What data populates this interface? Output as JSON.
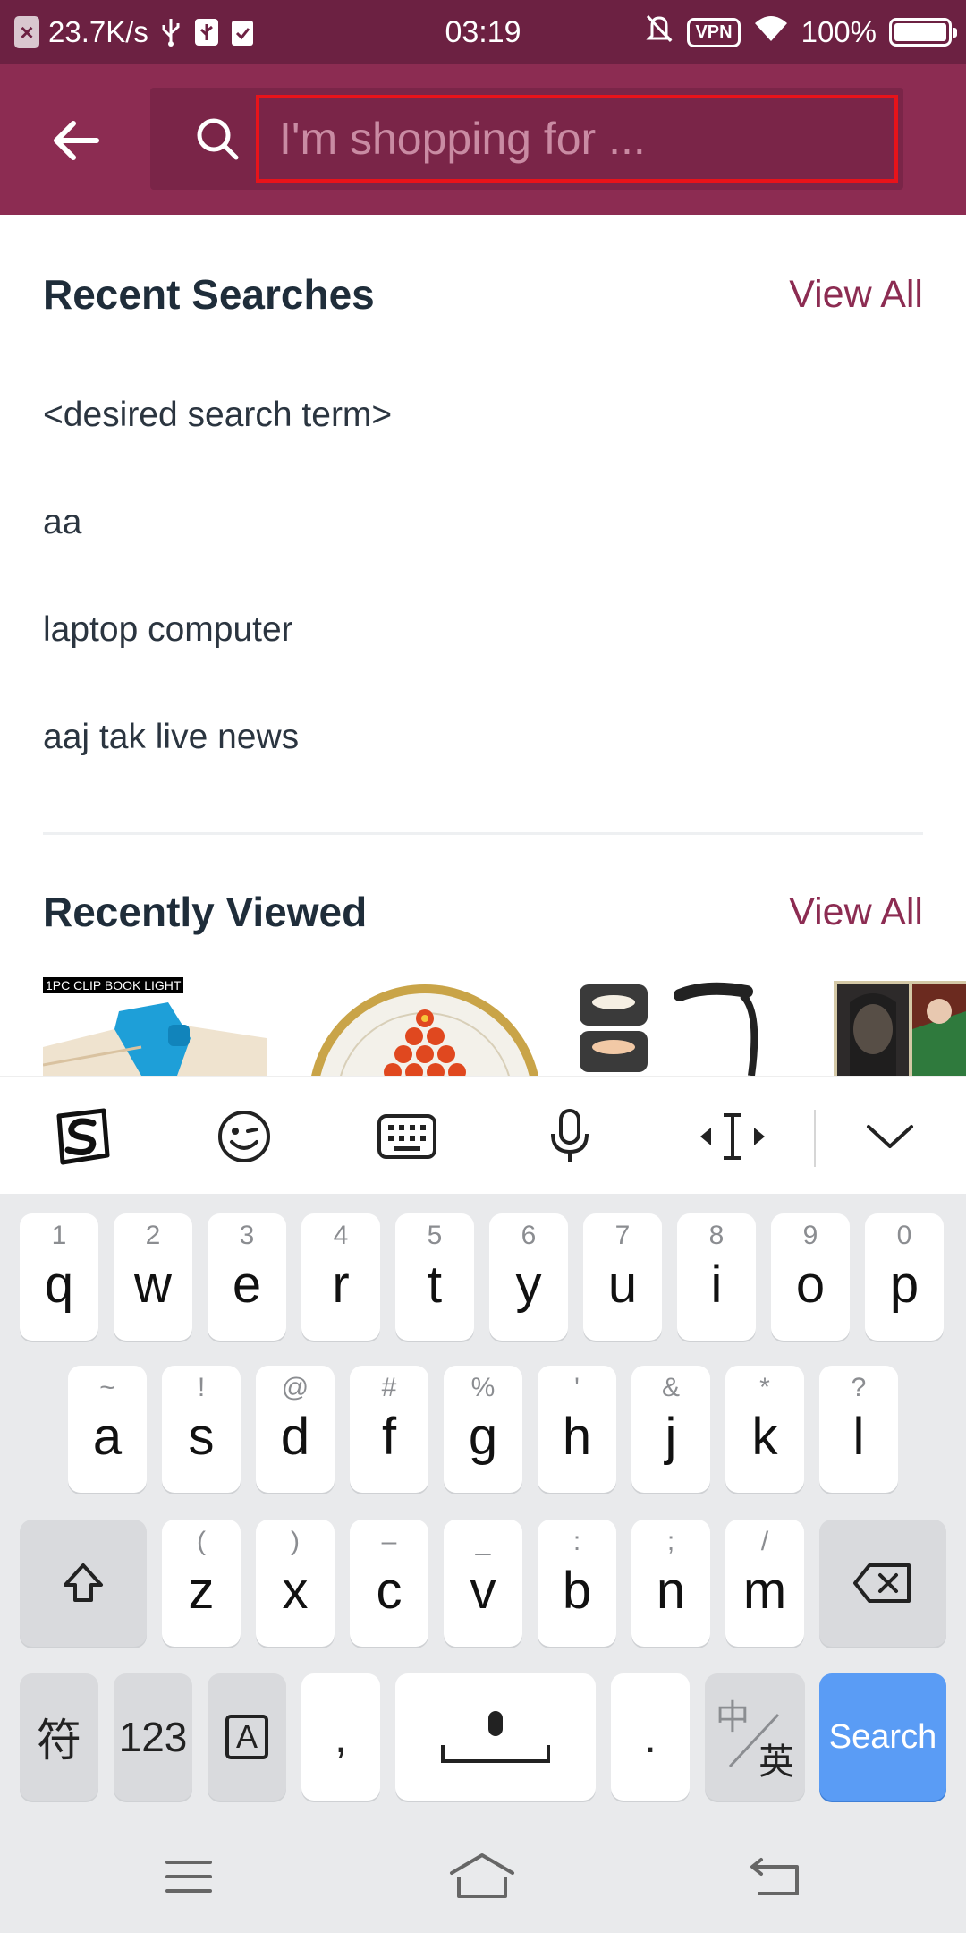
{
  "status_bar": {
    "speed": "23.7K/s",
    "time": "03:19",
    "vpn": "VPN",
    "battery": "100%"
  },
  "header": {
    "search_placeholder": "I'm shopping for ..."
  },
  "recent_searches": {
    "title": "Recent Searches",
    "view_all": "View All",
    "items": [
      "<desired search term>",
      "aa",
      "laptop computer",
      "aaj tak live news"
    ]
  },
  "recently_viewed": {
    "title": "Recently Viewed",
    "view_all": "View All",
    "items": [
      {
        "caption": "1PC CLIP BOOK LIGHT"
      },
      {
        "caption": ""
      },
      {
        "caption": ""
      },
      {
        "caption": ""
      }
    ]
  },
  "keyboard": {
    "row1": [
      {
        "hint": "1",
        "key": "q"
      },
      {
        "hint": "2",
        "key": "w"
      },
      {
        "hint": "3",
        "key": "e"
      },
      {
        "hint": "4",
        "key": "r"
      },
      {
        "hint": "5",
        "key": "t"
      },
      {
        "hint": "6",
        "key": "y"
      },
      {
        "hint": "7",
        "key": "u"
      },
      {
        "hint": "8",
        "key": "i"
      },
      {
        "hint": "9",
        "key": "o"
      },
      {
        "hint": "0",
        "key": "p"
      }
    ],
    "row2": [
      {
        "hint": "~",
        "key": "a"
      },
      {
        "hint": "!",
        "key": "s"
      },
      {
        "hint": "@",
        "key": "d"
      },
      {
        "hint": "#",
        "key": "f"
      },
      {
        "hint": "%",
        "key": "g"
      },
      {
        "hint": "'",
        "key": "h"
      },
      {
        "hint": "&",
        "key": "j"
      },
      {
        "hint": "*",
        "key": "k"
      },
      {
        "hint": "?",
        "key": "l"
      }
    ],
    "row3": [
      {
        "hint": "(",
        "key": "z"
      },
      {
        "hint": ")",
        "key": "x"
      },
      {
        "hint": "–",
        "key": "c"
      },
      {
        "hint": "_",
        "key": "v"
      },
      {
        "hint": ":",
        "key": "b"
      },
      {
        "hint": ";",
        "key": "n"
      },
      {
        "hint": "/",
        "key": "m"
      }
    ],
    "symbols_key": "符",
    "numbers_key": "123",
    "comma_key": ",",
    "period_key": ".",
    "lang_top": "中",
    "lang_bottom": "英",
    "search_key": "Search",
    "letter_key": "A"
  }
}
